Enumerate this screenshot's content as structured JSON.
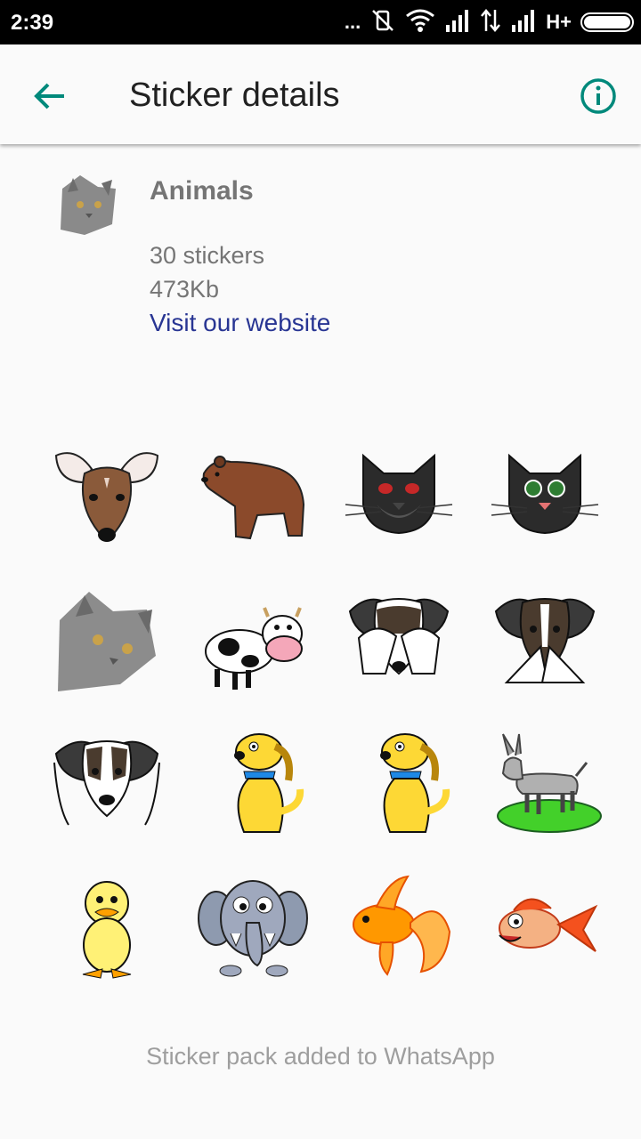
{
  "status_bar": {
    "time": "2:39",
    "dots": "...",
    "network": "H+"
  },
  "app_bar": {
    "title": "Sticker details",
    "back_icon": "arrow-back-icon",
    "info_icon": "info-icon"
  },
  "pack": {
    "name": "Animals",
    "count": "30 stickers",
    "size": "473Kb",
    "website_link": "Visit our website"
  },
  "stickers": [
    "deer",
    "brown-bear",
    "black-cat-red-eyes",
    "black-cat-green-eyes",
    "grey-cat-photo",
    "cow",
    "dog-covering-eyes",
    "dog-covering-mouth",
    "dog-covering-ears",
    "yellow-dog",
    "yellow-dog-2",
    "donkey",
    "duckling",
    "elephant",
    "goldfish",
    "funny-fish"
  ],
  "footer": {
    "status": "Sticker pack added to WhatsApp"
  }
}
